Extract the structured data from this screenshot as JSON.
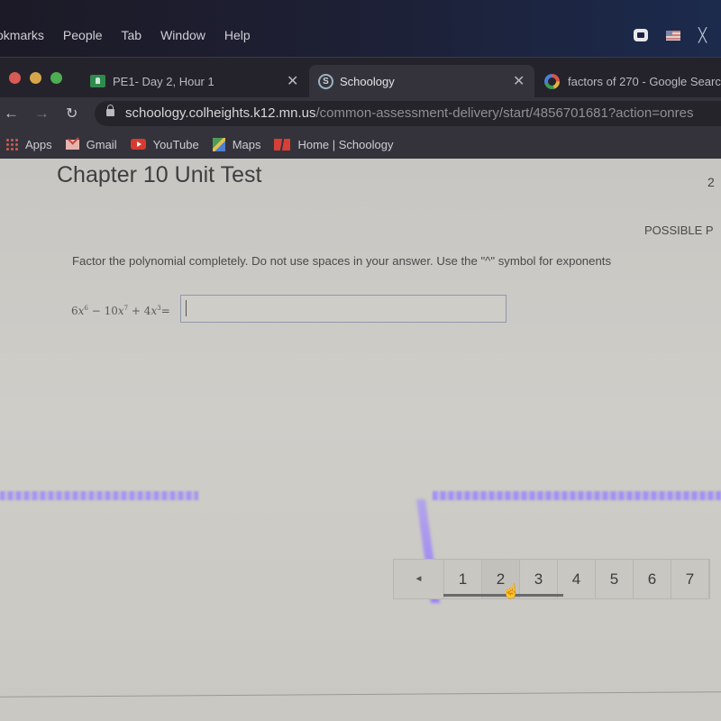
{
  "menubar": {
    "items": [
      "okmarks",
      "People",
      "Tab",
      "Window",
      "Help"
    ],
    "tray_icons": [
      "zoom-video-icon",
      "us-flag-input-icon",
      "bluetooth-off-icon"
    ]
  },
  "tabs": [
    {
      "label": "PE1- Day 2, Hour 1",
      "icon": "google-classroom-icon",
      "active": false
    },
    {
      "label": "Schoology",
      "icon": "schoology-icon",
      "favicon_letter": "S",
      "active": true
    },
    {
      "label": "factors of 270 - Google Searc",
      "icon": "google-icon",
      "active": false
    }
  ],
  "toolbar": {
    "url_host": "schoology.colheights.k12.mn.us",
    "url_path": "/common-assessment-delivery/start/4856701681?action=onres"
  },
  "bookmarks": [
    {
      "label": "Apps",
      "icon": "apps-grid-icon"
    },
    {
      "label": "Gmail",
      "icon": "gmail-icon"
    },
    {
      "label": "YouTube",
      "icon": "youtube-icon"
    },
    {
      "label": "Maps",
      "icon": "maps-icon"
    },
    {
      "label": "Home | Schoology",
      "icon": "schoology-bookmark-icon"
    }
  ],
  "page": {
    "title": "Chapter 10 Unit Test",
    "question_number_fragment": "2",
    "possible_points_label": "POSSIBLE P",
    "instructions": "Factor the polynomial completely.  Do not use spaces in your answer.  Use the \"^\" symbol for exponents",
    "expression": {
      "t1_coef": "6",
      "t1_var": "x",
      "t1_exp": "6",
      "op1": " − ",
      "t2_coef": "10",
      "t2_var": "x",
      "t2_exp": "7",
      "op2": " + ",
      "t3_coef": "4",
      "t3_var": "x",
      "t3_exp": "3",
      "equals": "="
    },
    "answer_value": ""
  },
  "pagination": {
    "prev_glyph": "◄",
    "pages": [
      "1",
      "2",
      "3",
      "4",
      "5",
      "6",
      "7"
    ],
    "hovered_page": "2"
  }
}
